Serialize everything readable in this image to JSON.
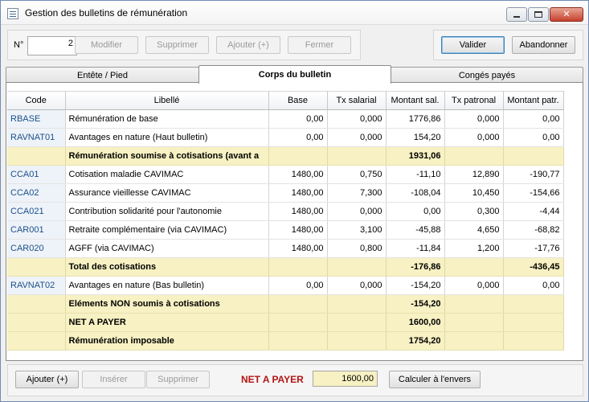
{
  "window": {
    "title": "Gestion des bulletins de rémunération"
  },
  "toolbar": {
    "number_label": "N°",
    "number_value": "2",
    "modifier": "Modifier",
    "supprimer": "Supprimer",
    "ajouter": "Ajouter (+)",
    "fermer": "Fermer",
    "valider": "Valider",
    "abandonner": "Abandonner"
  },
  "tabs": [
    "Entête / Pied",
    "Corps du bulletin",
    "Congés payés"
  ],
  "grid": {
    "columns": [
      "Code",
      "Libellé",
      "Base",
      "Tx salarial",
      "Montant sal.",
      "Tx patronal",
      "Montant patr."
    ],
    "rows": [
      {
        "type": "line",
        "code": "RBASE",
        "label": "Rémunération de base",
        "base": "0,00",
        "tx_sal": "0,000",
        "mt_sal": "1776,86",
        "tx_pat": "0,000",
        "mt_pat": "0,00"
      },
      {
        "type": "line",
        "code": "RAVNAT01",
        "label": "Avantages en nature (Haut bulletin)",
        "base": "0,00",
        "tx_sal": "0,000",
        "mt_sal": "154,20",
        "tx_pat": "0,000",
        "mt_pat": "0,00"
      },
      {
        "type": "sub",
        "code": "",
        "label": "Rémunération soumise à cotisations (avant a",
        "base": "",
        "tx_sal": "",
        "mt_sal": "1931,06",
        "tx_pat": "",
        "mt_pat": ""
      },
      {
        "type": "line",
        "code": "CCA01",
        "label": "Cotisation maladie CAVIMAC",
        "base": "1480,00",
        "tx_sal": "0,750",
        "mt_sal": "-11,10",
        "tx_pat": "12,890",
        "mt_pat": "-190,77"
      },
      {
        "type": "line",
        "code": "CCA02",
        "label": "Assurance vieillesse CAVIMAC",
        "base": "1480,00",
        "tx_sal": "7,300",
        "mt_sal": "-108,04",
        "tx_pat": "10,450",
        "mt_pat": "-154,66"
      },
      {
        "type": "line",
        "code": "CCA021",
        "label": "Contribution solidarité pour l'autonomie",
        "base": "1480,00",
        "tx_sal": "0,000",
        "mt_sal": "0,00",
        "tx_pat": "0,300",
        "mt_pat": "-4,44"
      },
      {
        "type": "line",
        "code": "CAR001",
        "label": "Retraite complémentaire (via CAVIMAC)",
        "base": "1480,00",
        "tx_sal": "3,100",
        "mt_sal": "-45,88",
        "tx_pat": "4,650",
        "mt_pat": "-68,82"
      },
      {
        "type": "line",
        "code": "CAR020",
        "label": "AGFF (via CAVIMAC)",
        "base": "1480,00",
        "tx_sal": "0,800",
        "mt_sal": "-11,84",
        "tx_pat": "1,200",
        "mt_pat": "-17,76"
      },
      {
        "type": "sub",
        "code": "",
        "label": "Total des cotisations",
        "base": "",
        "tx_sal": "",
        "mt_sal": "-176,86",
        "tx_pat": "",
        "mt_pat": "-436,45"
      },
      {
        "type": "line",
        "code": "RAVNAT02",
        "label": "Avantages en nature (Bas bulletin)",
        "base": "0,00",
        "tx_sal": "0,000",
        "mt_sal": "-154,20",
        "tx_pat": "0,000",
        "mt_pat": "0,00"
      },
      {
        "type": "sub",
        "code": "",
        "label": "Eléments NON soumis à cotisations",
        "base": "",
        "tx_sal": "",
        "mt_sal": "-154,20",
        "tx_pat": "",
        "mt_pat": ""
      },
      {
        "type": "sub",
        "code": "",
        "label": "NET A PAYER",
        "base": "",
        "tx_sal": "",
        "mt_sal": "1600,00",
        "tx_pat": "",
        "mt_pat": ""
      },
      {
        "type": "sub",
        "code": "",
        "label": "Rémunération imposable",
        "base": "",
        "tx_sal": "",
        "mt_sal": "1754,20",
        "tx_pat": "",
        "mt_pat": ""
      }
    ]
  },
  "bottom": {
    "ajouter": "Ajouter (+)",
    "inserer": "Insérer",
    "supprimer": "Supprimer",
    "net_label": "NET A PAYER",
    "net_value": "1600,00",
    "calculer": "Calculer à l'envers"
  }
}
